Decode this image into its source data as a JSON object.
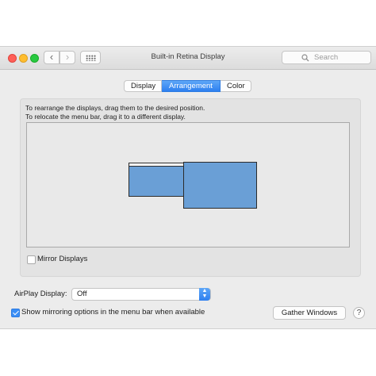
{
  "window": {
    "title": "Built-in Retina Display"
  },
  "toolbar": {
    "back_icon": "chevron-left-icon",
    "forward_icon": "chevron-right-icon",
    "grid_icon": "show-all-grid-icon",
    "search_placeholder": "Search"
  },
  "tabs": [
    {
      "label": "Display",
      "selected": false
    },
    {
      "label": "Arrangement",
      "selected": true
    },
    {
      "label": "Color",
      "selected": false
    }
  ],
  "instructions": {
    "line1": "To rearrange the displays, drag them to the desired position.",
    "line2": "To relocate the menu bar, drag it to a different display."
  },
  "arrangement": {
    "displays": [
      "display-with-menu-bar",
      "secondary-display"
    ],
    "display_color": "#6a9fd6"
  },
  "mirror": {
    "label": "Mirror Displays",
    "checked": false
  },
  "airplay": {
    "label": "AirPlay Display:",
    "value": "Off"
  },
  "mirroring_options": {
    "label": "Show mirroring options in the menu bar when available",
    "checked": true
  },
  "buttons": {
    "gather": "Gather Windows",
    "help": "?"
  },
  "colors": {
    "accent": "#2d7ff0",
    "close": "#ff5f57",
    "minimize": "#ffbd2e",
    "zoom": "#28c940"
  }
}
